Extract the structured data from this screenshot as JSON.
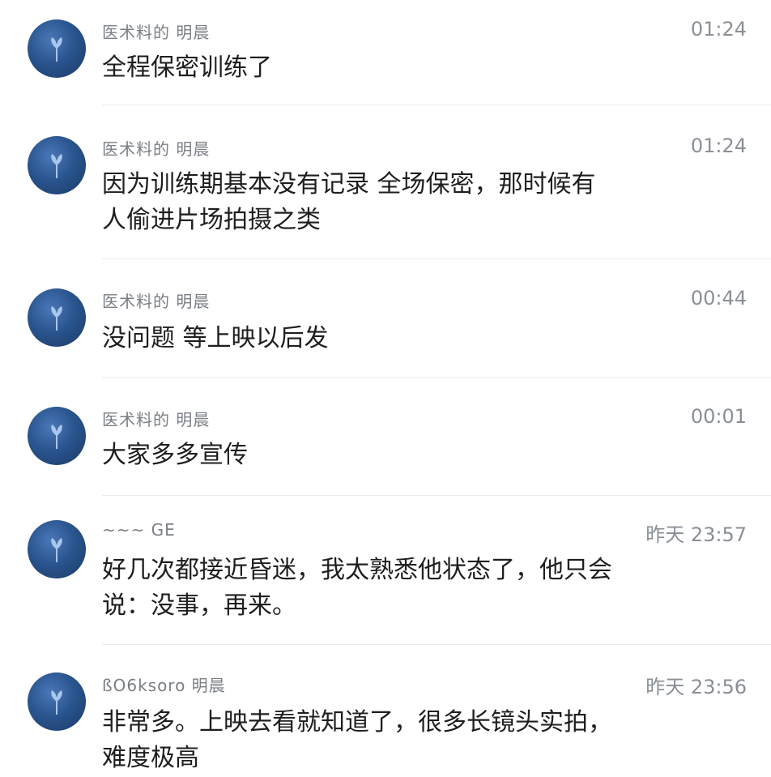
{
  "messages": [
    {
      "sender": "医术料的  明晨",
      "time": "01:24",
      "lines": [
        "全程保密训练了"
      ]
    },
    {
      "sender": "医术料的  明晨",
      "time": "01:24",
      "lines": [
        "因为训练期基本没有记录 全场保密，那时候有",
        "人偷进片场拍摄之类"
      ]
    },
    {
      "sender": "医术料的  明晨",
      "time": "00:44",
      "lines": [
        "没问题 等上映以后发"
      ]
    },
    {
      "sender": "医术料的  明晨",
      "time": "00:01",
      "lines": [
        "大家多多宣传"
      ]
    },
    {
      "sender": "~~~  GE",
      "time": "昨天 23:57",
      "lines": [
        "好几次都接近昏迷，我太熟悉他状态了，他只会",
        "说：没事，再来。"
      ]
    },
    {
      "sender": "ßO6ksoro 明晨",
      "time": "昨天 23:56",
      "lines": [
        "非常多。上映去看就知道了，很多长镜头实拍，",
        "难度极高"
      ]
    }
  ],
  "avatar_icon": "sprout-icon",
  "colors": {
    "avatar_blue": "#2a558f",
    "text": "#1e1e1e",
    "meta": "#8a8f96"
  }
}
